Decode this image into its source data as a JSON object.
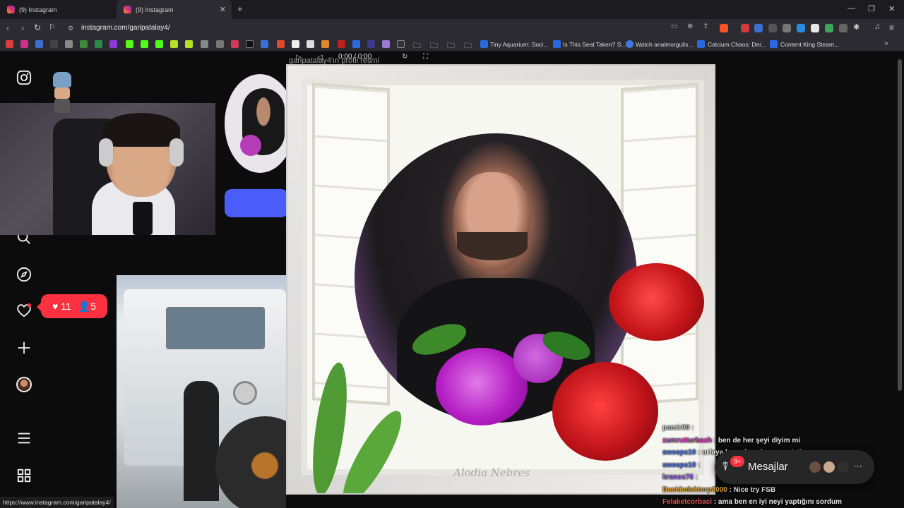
{
  "browser": {
    "tabs": [
      {
        "label": "(9) Instagram"
      },
      {
        "label": "(9) Instagram"
      }
    ],
    "url": "instagram.com/garipatalay4/",
    "bookmarks": [
      {
        "label": "Tiny Aquarium: Soci..."
      },
      {
        "label": "Is This Seat Taken? S..."
      },
      {
        "label": "Watch analmorgulis..."
      },
      {
        "label": "Calcium Chaos: Der..."
      },
      {
        "label": "Content King Steam..."
      }
    ],
    "status_url": "https://www.instagram.com/garipatalay4/"
  },
  "sidebar": {
    "icons": [
      "instagram-logo-icon",
      "search-icon",
      "explore-icon",
      "heart-icon",
      "create-icon",
      "profile-avatar",
      "menu-icon",
      "more-apps-icon"
    ]
  },
  "notifications": {
    "likes": "11",
    "followers": "5"
  },
  "modal": {
    "title": "garipatalay4'ın profil resmi",
    "video_time": "0:00 / 0:00",
    "watermark": "Alodia Nebres"
  },
  "chat": [
    {
      "user": "pamir90",
      "sep": " :",
      "msg": "",
      "color": "#c7c7c7"
    },
    {
      "user": "zumrutturbash",
      "sep": " :",
      "msg": " ben de her şeyi diyim mi",
      "color": "#d14cc6"
    },
    {
      "user": "sweeps10",
      "sep": " :",
      "msg": " urfaya kargolasınlar mı ne istiyo",
      "color": "#4f7be0"
    },
    {
      "user": "sweeps10",
      "sep": " :",
      "msg": "",
      "color": "#4f7be0"
    },
    {
      "user": "kranos76",
      "sep": " :",
      "msg": "",
      "color": "#9b6be0"
    },
    {
      "user": "Bacidedektorp2000",
      "sep": " :",
      "msg": " Nice try FSB",
      "color": "#d9a23b"
    },
    {
      "user": "Felaketcorbaci",
      "sep": " :",
      "msg": " ama ben en iyi neyi yaptığını sordum",
      "color": "#e05252"
    }
  ],
  "messages": {
    "label": "Mesajlar",
    "badge": "9+"
  },
  "colors": {
    "accent": "#4a5df9",
    "notify": "#ff3040"
  }
}
